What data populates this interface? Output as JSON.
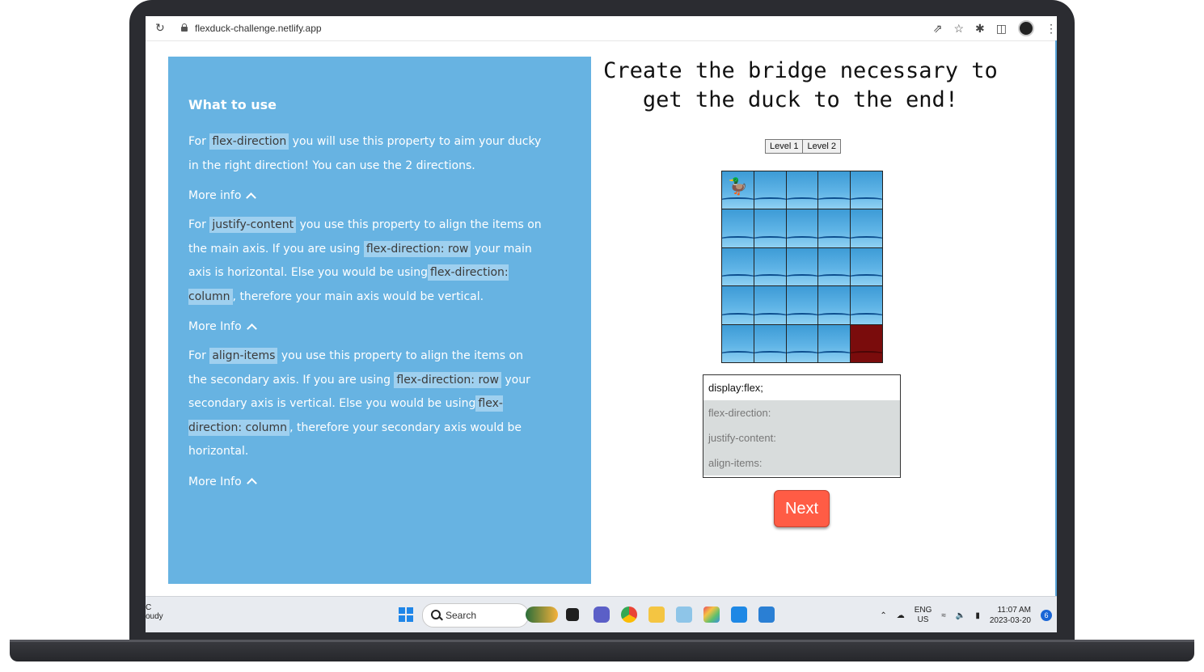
{
  "browser": {
    "url": "flexduck-challenge.netlify.app"
  },
  "panel": {
    "title": "What to use",
    "sections": [
      {
        "prefix": "For ",
        "code": "flex-direction",
        "text": " you will use this property to aim your ducky in the right direction! You can use the 2 directions.",
        "more": "More info"
      },
      {
        "prefix": "For ",
        "code": "justify-content",
        "text_a": " you use this property to align the items on the main axis. If you are using ",
        "code_b": "flex-direction: row",
        "text_b": " your main axis is horizontal. Else you would be using",
        "code_c": "flex-direction: column",
        "text_c": ", therefore your main axis would be vertical.",
        "more": "More Info"
      },
      {
        "prefix": "For ",
        "code": "align-items",
        "text_a": " you use this property to align the items on the secondary axis. If you are using ",
        "code_b": "flex-direction: row",
        "text_b": " your secondary axis is vertical. Else you would be using",
        "code_c": "flex-direction: column",
        "text_c": ", therefore your secondary axis would be horizontal.",
        "more": "More Info"
      }
    ]
  },
  "game": {
    "heading": "Create the bridge necessary to get the duck to the end!",
    "levels": [
      "Level 1",
      "Level 2"
    ],
    "grid": {
      "rows": 5,
      "cols": 5,
      "duck": [
        0,
        0
      ],
      "goal": [
        4,
        4
      ]
    },
    "code_line": "display:flex;",
    "placeholders": [
      "flex-direction:",
      "justify-content:",
      "align-items:"
    ],
    "next_label": "Next"
  },
  "taskbar": {
    "weather_top": "C",
    "weather_bottom": "oudy",
    "search_label": "Search",
    "lang_top": "ENG",
    "lang_bottom": "US",
    "time": "11:07 AM",
    "date": "2023-03-20",
    "notifications": "6"
  },
  "colors": {
    "panel": "#67b3e2",
    "next": "#ff5c45",
    "goal": "#7a0c0c"
  }
}
